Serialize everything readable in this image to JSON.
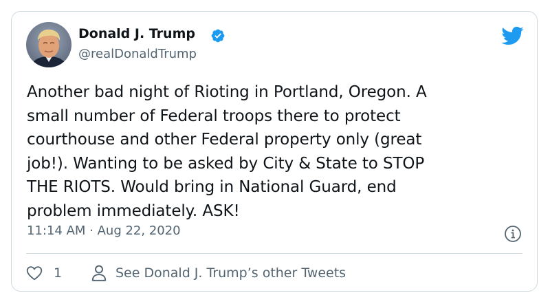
{
  "author": {
    "display_name": "Donald J. Trump",
    "handle": "@realDonaldTrump",
    "verified": true,
    "avatar_icon": "profile-photo"
  },
  "tweet": {
    "text": "Another bad night of Rioting in Portland, Oregon. A\nsmall number of Federal troops there to protect\ncourthouse and other Federal property only (great\njob!). Wanting to be asked by City & State to STOP\nTHE RIOTS. Would bring in National Guard, end\nproblem immediately. ASK!",
    "timestamp": "11:14 AM · Aug 22, 2020"
  },
  "actions": {
    "like_count": "1",
    "other_tweets_label": "See Donald J. Trump’s other Tweets"
  },
  "icons": {
    "brand": "twitter-bird-icon",
    "verified": "verified-badge-icon",
    "info": "info-icon",
    "like": "heart-icon",
    "profile": "person-icon"
  },
  "colors": {
    "brand": "#1d9bf0",
    "text": "#0f1419",
    "secondary": "#536471",
    "border": "#cfd9de"
  }
}
